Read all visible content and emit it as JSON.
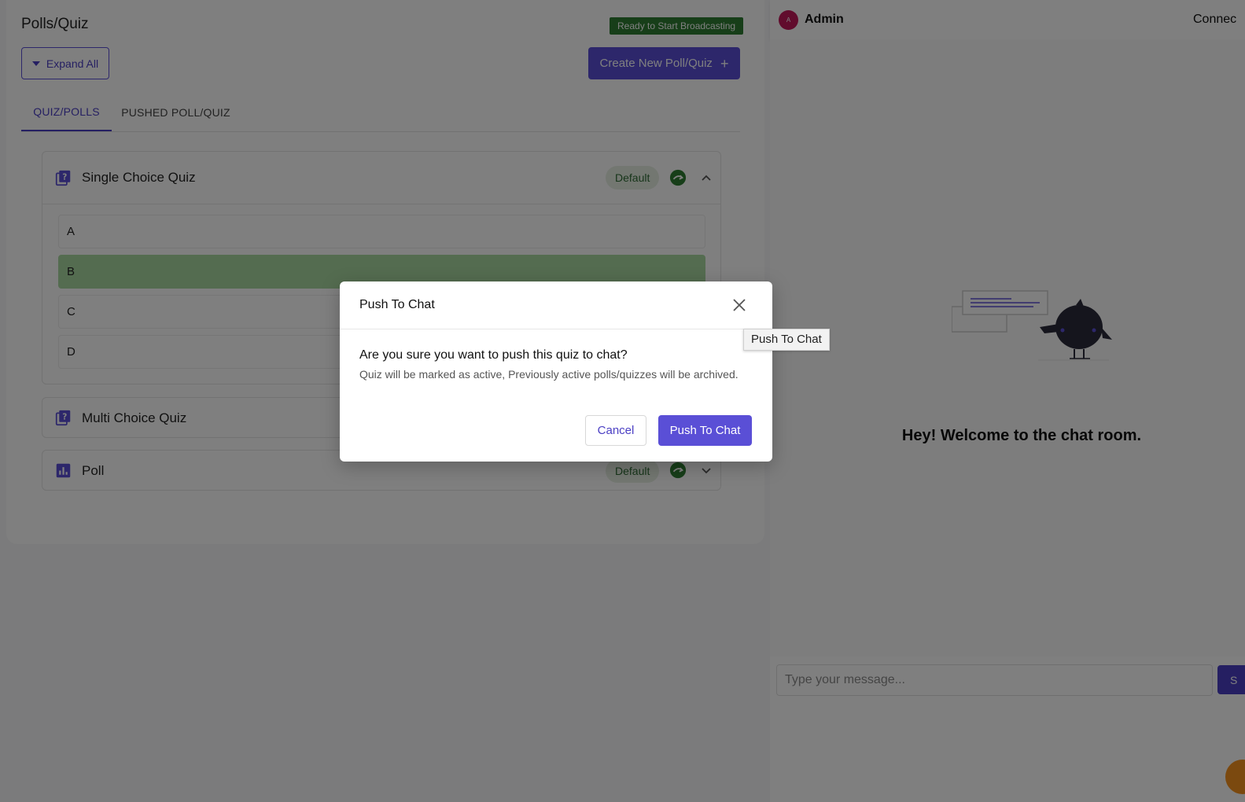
{
  "polls_panel": {
    "title": "Polls/Quiz",
    "status_badge": "Ready to Start Broadcasting",
    "expand_all_label": "Expand All",
    "create_label": "Create New Poll/Quiz",
    "tabs": [
      {
        "label": "QUIZ/POLLS",
        "active": true
      },
      {
        "label": "PUSHED POLL/QUIZ",
        "active": false
      }
    ],
    "cards": [
      {
        "title": "Single Choice Quiz",
        "icon": "quiz-icon",
        "badge": "Default",
        "expanded": true,
        "options": [
          {
            "label": "A",
            "correct": false
          },
          {
            "label": "B",
            "correct": true
          },
          {
            "label": "C",
            "correct": false
          },
          {
            "label": "D",
            "correct": false
          }
        ]
      },
      {
        "title": "Multi Choice Quiz",
        "icon": "quiz-icon",
        "expanded": false
      },
      {
        "title": "Poll",
        "icon": "poll-chart-icon",
        "badge": "Default",
        "expanded": false
      }
    ]
  },
  "chat": {
    "avatar_initial": "A",
    "user_name": "Admin",
    "status": "Connec",
    "welcome": "Hey! Welcome to the chat room.",
    "input_placeholder": "Type your message...",
    "send_label": "S"
  },
  "modal": {
    "title": "Push To Chat",
    "question": "Are you sure you want to push this quiz to chat?",
    "note": "Quiz will be marked as active, Previously active polls/quizzes will be archived.",
    "cancel_label": "Cancel",
    "confirm_label": "Push To Chat"
  },
  "tooltip": "Push To Chat",
  "colors": {
    "accent": "#5a4fd6",
    "success": "#2e7d32",
    "correct_option": "#a8d9a0",
    "avatar": "#c2185b",
    "fab": "#f7931e"
  }
}
